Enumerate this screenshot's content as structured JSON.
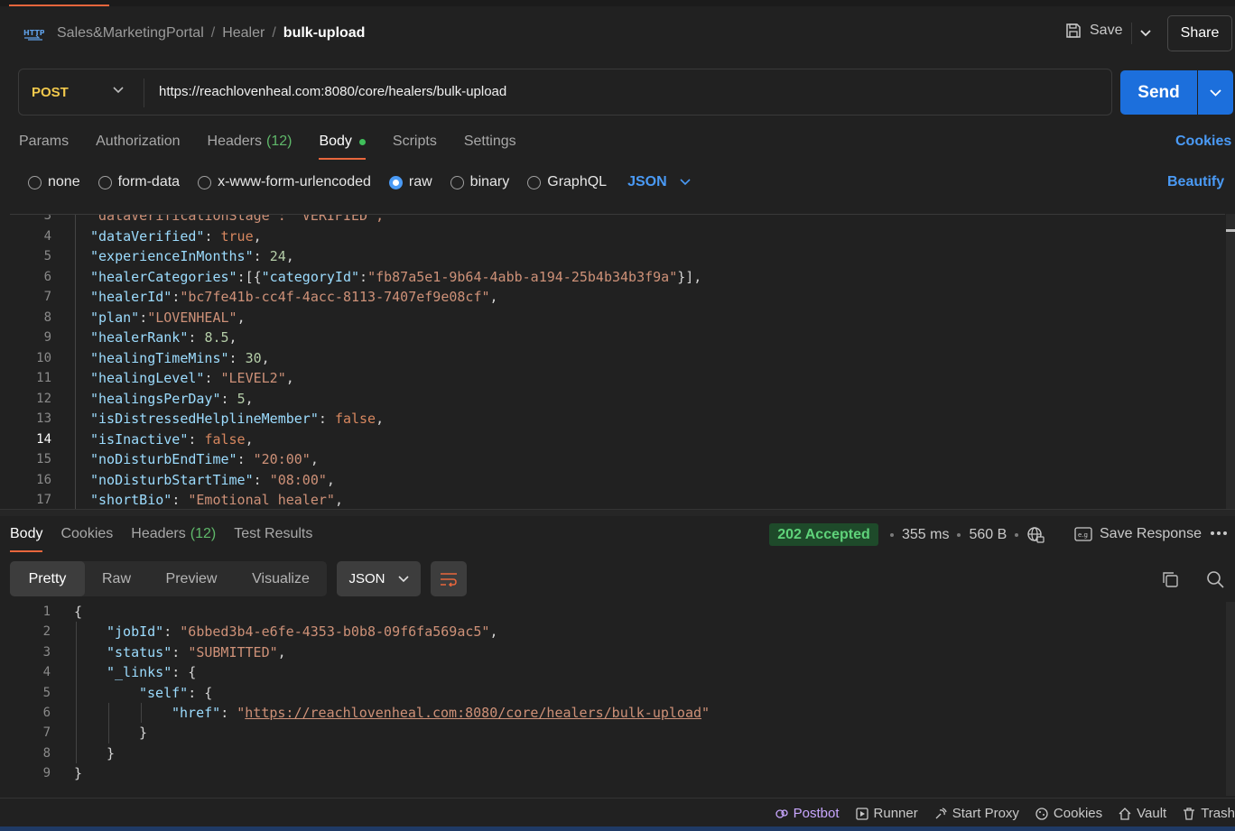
{
  "header": {
    "breadcrumb": [
      "Sales&MarketingPortal",
      "Healer",
      "bulk-upload"
    ],
    "save_label": "Save",
    "share_label": "Share"
  },
  "request": {
    "method": "POST",
    "url": "https://reachlovenheal.com:8080/core/healers/bulk-upload",
    "send_label": "Send",
    "tabs": [
      {
        "label": "Params"
      },
      {
        "label": "Authorization"
      },
      {
        "label": "Headers",
        "count": "(12)"
      },
      {
        "label": "Body",
        "active": true
      },
      {
        "label": "Scripts"
      },
      {
        "label": "Settings"
      }
    ],
    "cookies_label": "Cookies",
    "body_types": [
      "none",
      "form-data",
      "x-www-form-urlencoded",
      "raw",
      "binary",
      "GraphQL"
    ],
    "body_type_selected": "raw",
    "body_lang": "JSON",
    "beautify_label": "Beautify",
    "editor_lines": [
      {
        "n": "3",
        "text": "\"dataVerificationStage\": \"VERIFIED\","
      },
      {
        "n": "4",
        "key": "\"dataVerified\"",
        "sep": ": ",
        "val": "true",
        "vt": "b",
        "end": ","
      },
      {
        "n": "5",
        "key": "\"experienceInMonths\"",
        "sep": ": ",
        "val": "24",
        "vt": "n",
        "end": ","
      },
      {
        "n": "6",
        "key": "\"healerCategories\"",
        "sep": ":[{",
        "key2": "\"categoryId\"",
        "sep2": ":",
        "val": "\"fb87a5e1-9b64-4abb-a194-25b4b34b3f9a\"",
        "vt": "s",
        "end": "}],"
      },
      {
        "n": "7",
        "key": "\"healerId\"",
        "sep": ":",
        "val": "\"bc7fe41b-cc4f-4acc-8113-7407ef9e08cf\"",
        "vt": "s",
        "end": ","
      },
      {
        "n": "8",
        "key": "\"plan\"",
        "sep": ":",
        "val": "\"LOVENHEAL\"",
        "vt": "s",
        "end": ","
      },
      {
        "n": "9",
        "key": "\"healerRank\"",
        "sep": ": ",
        "val": "8.5",
        "vt": "n",
        "end": ","
      },
      {
        "n": "10",
        "key": "\"healingTimeMins\"",
        "sep": ": ",
        "val": "30",
        "vt": "n",
        "end": ","
      },
      {
        "n": "11",
        "key": "\"healingLevel\"",
        "sep": ": ",
        "val": "\"LEVEL2\"",
        "vt": "s",
        "end": ","
      },
      {
        "n": "12",
        "key": "\"healingsPerDay\"",
        "sep": ": ",
        "val": "5",
        "vt": "n",
        "end": ","
      },
      {
        "n": "13",
        "key": "\"isDistressedHelplineMember\"",
        "sep": ": ",
        "val": "false",
        "vt": "b",
        "end": ","
      },
      {
        "n": "14",
        "key": "\"isInactive\"",
        "sep": ": ",
        "val": "false",
        "vt": "b",
        "end": ",",
        "current": true
      },
      {
        "n": "15",
        "key": "\"noDisturbEndTime\"",
        "sep": ": ",
        "val": "\"20:00\"",
        "vt": "s",
        "end": ","
      },
      {
        "n": "16",
        "key": "\"noDisturbStartTime\"",
        "sep": ": ",
        "val": "\"08:00\"",
        "vt": "s",
        "end": ","
      },
      {
        "n": "17",
        "key": "\"shortBio\"",
        "sep": ": ",
        "val": "\"Emotional healer\"",
        "vt": "s",
        "end": ","
      }
    ]
  },
  "response": {
    "tabs": [
      {
        "label": "Body",
        "active": true
      },
      {
        "label": "Cookies"
      },
      {
        "label": "Headers",
        "count": "(12)"
      },
      {
        "label": "Test Results"
      }
    ],
    "status": "202 Accepted",
    "time": "355 ms",
    "size": "560 B",
    "save_response_label": "Save Response",
    "views": [
      "Pretty",
      "Raw",
      "Preview",
      "Visualize"
    ],
    "view_selected": "Pretty",
    "format": "JSON",
    "lines": [
      {
        "n": "1",
        "indent": 0,
        "parts": [
          [
            "p",
            "{"
          ]
        ]
      },
      {
        "n": "2",
        "indent": 1,
        "parts": [
          [
            "k",
            "\"jobId\""
          ],
          [
            "p",
            ": "
          ],
          [
            "s",
            "\"6bbed3b4-e6fe-4353-b0b8-09f6fa569ac5\""
          ],
          [
            "p",
            ","
          ]
        ]
      },
      {
        "n": "3",
        "indent": 1,
        "parts": [
          [
            "k",
            "\"status\""
          ],
          [
            "p",
            ": "
          ],
          [
            "s",
            "\"SUBMITTED\""
          ],
          [
            "p",
            ","
          ]
        ]
      },
      {
        "n": "4",
        "indent": 1,
        "parts": [
          [
            "k",
            "\"_links\""
          ],
          [
            "p",
            ": {"
          ]
        ]
      },
      {
        "n": "5",
        "indent": 2,
        "parts": [
          [
            "k",
            "\"self\""
          ],
          [
            "p",
            ": {"
          ]
        ]
      },
      {
        "n": "6",
        "indent": 3,
        "parts": [
          [
            "k",
            "\"href\""
          ],
          [
            "p",
            ": "
          ],
          [
            "s",
            "\""
          ],
          [
            "link",
            "https://reachlovenheal.com:8080/core/healers/bulk-upload"
          ],
          [
            "s",
            "\""
          ]
        ]
      },
      {
        "n": "7",
        "indent": 2,
        "parts": [
          [
            "p",
            "}"
          ]
        ]
      },
      {
        "n": "8",
        "indent": 1,
        "parts": [
          [
            "p",
            "}"
          ]
        ]
      },
      {
        "n": "9",
        "indent": 0,
        "parts": [
          [
            "p",
            "}"
          ]
        ]
      }
    ]
  },
  "footer": {
    "items": [
      "Postbot",
      "Runner",
      "Start Proxy",
      "Cookies",
      "Vault",
      "Trash"
    ]
  },
  "colors": {
    "accent": "#e8663c",
    "send_blue": "#1c6fdc",
    "link_blue": "#4a9af5",
    "status_green": "#5fd37a"
  }
}
